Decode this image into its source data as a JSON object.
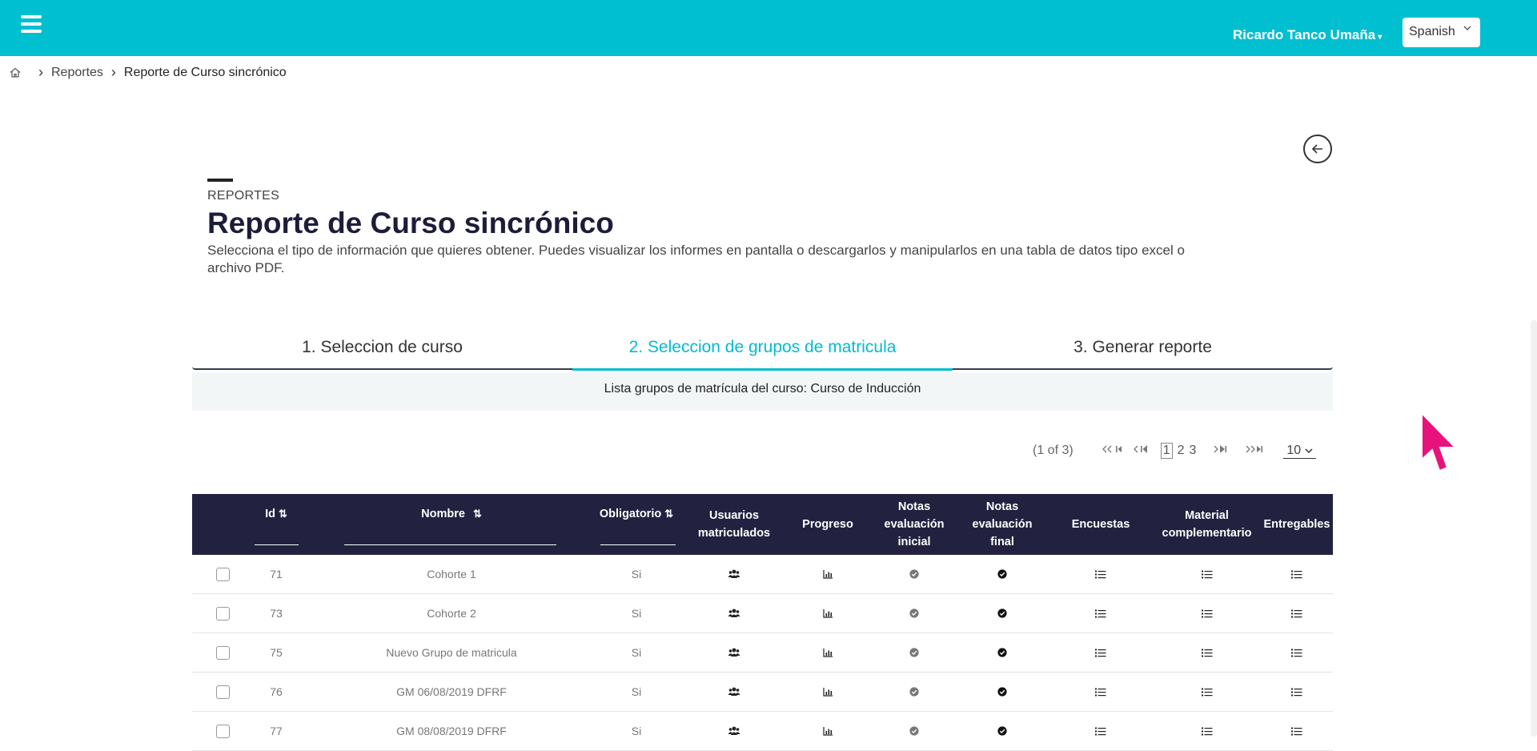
{
  "topbar": {
    "user_name": "Ricardo Tanco Umaña",
    "user_caret": "▾",
    "language": "Spanish"
  },
  "breadcrumb": {
    "items": [
      "Reportes",
      "Reporte de Curso sincrónico"
    ]
  },
  "header": {
    "kicker": "REPORTES",
    "title": "Reporte de Curso sincrónico",
    "description": "Selecciona el tipo de información que quieres obtener. Puedes visualizar los informes en pantalla o descargarlos y manipularlos en una tabla de datos tipo excel o archivo PDF."
  },
  "steps": [
    {
      "label": "1. Seleccion de curso",
      "active": false
    },
    {
      "label": "2. Seleccion de grupos de matricula",
      "active": true
    },
    {
      "label": "3. Generar reporte",
      "active": false
    }
  ],
  "list_caption": "Lista grupos de matrícula del curso: Curso de Inducción",
  "paginator": {
    "status": "(1 of 3)",
    "pages": [
      "1",
      "2",
      "3"
    ],
    "current_page": "1",
    "rows_per_page": "10"
  },
  "table": {
    "columns": {
      "id": "Id",
      "nombre": "Nombre",
      "obligatorio": "Obligatorio",
      "usuarios": "Usuarios matriculados",
      "progreso": "Progreso",
      "notas_inicial": "Notas evaluación inicial",
      "notas_final": "Notas evaluación final",
      "encuestas": "Encuestas",
      "material": "Material complementario",
      "entregables": "Entregables"
    },
    "sort_icon": "⇅",
    "rows": [
      {
        "id": "71",
        "nombre": "Cohorte 1",
        "obligatorio": "Si"
      },
      {
        "id": "73",
        "nombre": "Cohorte 2",
        "obligatorio": "Si"
      },
      {
        "id": "75",
        "nombre": "Nuevo Grupo de matricula",
        "obligatorio": "Si"
      },
      {
        "id": "76",
        "nombre": "GM 06/08/2019 DFRF",
        "obligatorio": "Si"
      },
      {
        "id": "77",
        "nombre": "GM 08/08/2019 DFRF",
        "obligatorio": "Si"
      }
    ]
  },
  "colors": {
    "topbar": "#00bfd0",
    "accent": "#00bcd0",
    "table_header": "#222240",
    "cursor": "#e8127c"
  }
}
